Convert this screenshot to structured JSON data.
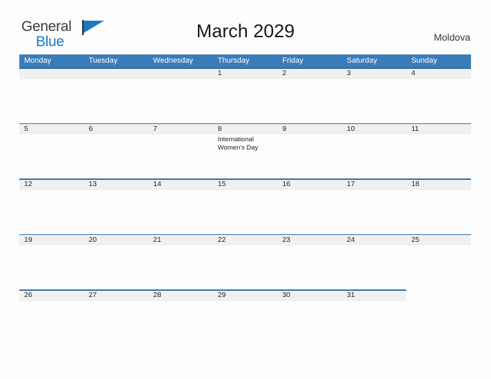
{
  "brand": {
    "name_part1": "General",
    "name_part2": "Blue",
    "flag_icon": "blue-flag-triangle",
    "color_primary": "#1b79c4",
    "color_text": "#3b3b3b"
  },
  "header": {
    "title": "March 2029",
    "country": "Moldova"
  },
  "theme": {
    "header_blue": "#3a7cb8",
    "rule_blue": "#2e6da4",
    "band_gray": "#f0f0f0",
    "page_background": "#fdfdfd"
  },
  "calendar": {
    "weekdays": [
      "Monday",
      "Tuesday",
      "Wednesday",
      "Thursday",
      "Friday",
      "Saturday",
      "Sunday"
    ],
    "weeks": [
      {
        "band_columns": 7,
        "days": [
          {
            "number": "",
            "events": []
          },
          {
            "number": "",
            "events": []
          },
          {
            "number": "",
            "events": []
          },
          {
            "number": "1",
            "events": []
          },
          {
            "number": "2",
            "events": []
          },
          {
            "number": "3",
            "events": []
          },
          {
            "number": "4",
            "events": []
          }
        ]
      },
      {
        "band_columns": 7,
        "days": [
          {
            "number": "5",
            "events": []
          },
          {
            "number": "6",
            "events": []
          },
          {
            "number": "7",
            "events": []
          },
          {
            "number": "8",
            "events": [
              "International Women's Day"
            ]
          },
          {
            "number": "9",
            "events": []
          },
          {
            "number": "10",
            "events": []
          },
          {
            "number": "11",
            "events": []
          }
        ]
      },
      {
        "band_columns": 7,
        "days": [
          {
            "number": "12",
            "events": []
          },
          {
            "number": "13",
            "events": []
          },
          {
            "number": "14",
            "events": []
          },
          {
            "number": "15",
            "events": []
          },
          {
            "number": "16",
            "events": []
          },
          {
            "number": "17",
            "events": []
          },
          {
            "number": "18",
            "events": []
          }
        ]
      },
      {
        "band_columns": 7,
        "days": [
          {
            "number": "19",
            "events": []
          },
          {
            "number": "20",
            "events": []
          },
          {
            "number": "21",
            "events": []
          },
          {
            "number": "22",
            "events": []
          },
          {
            "number": "23",
            "events": []
          },
          {
            "number": "24",
            "events": []
          },
          {
            "number": "25",
            "events": []
          }
        ]
      },
      {
        "band_columns": 6,
        "days": [
          {
            "number": "26",
            "events": []
          },
          {
            "number": "27",
            "events": []
          },
          {
            "number": "28",
            "events": []
          },
          {
            "number": "29",
            "events": []
          },
          {
            "number": "30",
            "events": []
          },
          {
            "number": "31",
            "events": []
          },
          {
            "number": "",
            "events": []
          }
        ]
      }
    ]
  }
}
